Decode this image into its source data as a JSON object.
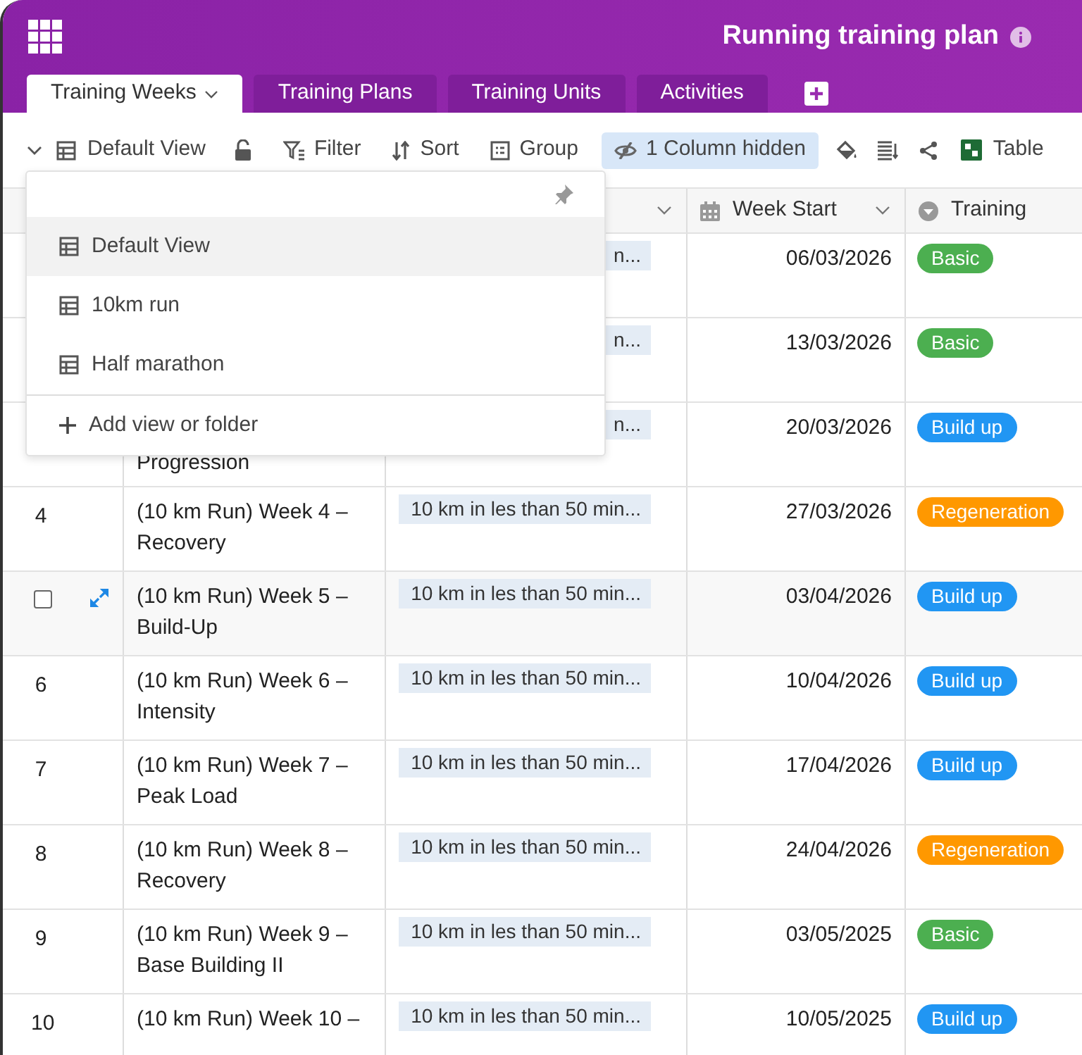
{
  "app": {
    "title": "Running training plan"
  },
  "tabs": [
    {
      "label": "Training Weeks",
      "selected": true
    },
    {
      "label": "Training Plans",
      "selected": false
    },
    {
      "label": "Training Units",
      "selected": false
    },
    {
      "label": "Activities",
      "selected": false
    }
  ],
  "toolbar": {
    "view": "Default View",
    "filter": "Filter",
    "sort": "Sort",
    "group": "Group",
    "hidden_columns": "1 Column hidden",
    "table": "Table"
  },
  "columns": [
    {
      "label": "Week Start",
      "kind": "date"
    },
    {
      "label": "Training",
      "kind": "select"
    }
  ],
  "rows": [
    {
      "plan": "n...",
      "week_start": "06/03/2026",
      "training": {
        "label": "Basic",
        "color": "#4caf50"
      }
    },
    {
      "plan": "n...",
      "week_start": "13/03/2026",
      "training": {
        "label": "Basic",
        "color": "#4caf50"
      }
    },
    {
      "title": "Progression",
      "plan": "n...",
      "week_start": "20/03/2026",
      "training": {
        "label": "Build up",
        "color": "#2196f3"
      }
    },
    {
      "number": "4",
      "title": "(10 km Run) Week 4 – Recovery",
      "plan": "10 km in les than 50 min...",
      "week_start": "27/03/2026",
      "training": {
        "label": "Regeneration",
        "color": "#ff9800"
      }
    },
    {
      "hovered": true,
      "checked": false,
      "title": "(10 km Run) Week 5 – Build-Up",
      "plan": "10 km in les than 50 min...",
      "week_start": "03/04/2026",
      "training": {
        "label": "Build up",
        "color": "#2196f3"
      }
    },
    {
      "number": "6",
      "title": "(10 km Run) Week 6 – Intensity",
      "plan": "10 km in les than 50 min...",
      "week_start": "10/04/2026",
      "training": {
        "label": "Build up",
        "color": "#2196f3"
      }
    },
    {
      "number": "7",
      "title": "(10 km Run) Week 7 – Peak Load",
      "plan": "10 km in les than 50 min...",
      "week_start": "17/04/2026",
      "training": {
        "label": "Build up",
        "color": "#2196f3"
      }
    },
    {
      "number": "8",
      "title": "(10 km Run) Week 8 – Recovery",
      "plan": "10 km in les than 50 min...",
      "week_start": "24/04/2026",
      "training": {
        "label": "Regeneration",
        "color": "#ff9800"
      }
    },
    {
      "number": "9",
      "title": "(10 km Run) Week 9 – Base Building II",
      "plan": "10 km in les than 50 min...",
      "week_start": "03/05/2025",
      "training": {
        "label": "Basic",
        "color": "#4caf50"
      }
    },
    {
      "number": "10",
      "title": "(10 km Run) Week 10 –",
      "plan": "10 km in les than 50 min...",
      "week_start": "10/05/2025",
      "training": {
        "label": "Build up",
        "color": "#2196f3"
      }
    }
  ],
  "view_menu": {
    "items": [
      {
        "label": "Default View",
        "selected": true
      },
      {
        "label": "10km run",
        "selected": false
      },
      {
        "label": "Half marathon",
        "selected": false
      }
    ],
    "add": "Add view or folder"
  }
}
